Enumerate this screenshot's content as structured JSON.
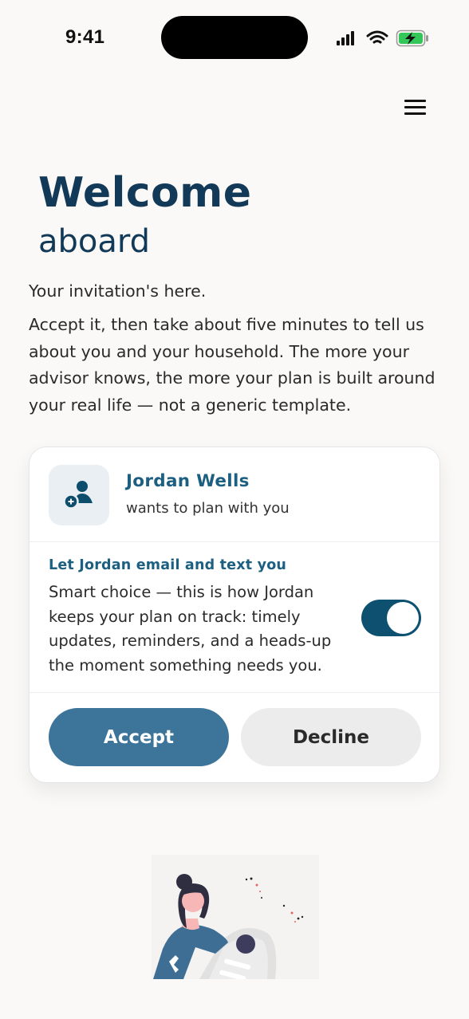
{
  "status_bar": {
    "time": "9:41"
  },
  "header": {
    "title": "Welcome",
    "subtitle": "aboard"
  },
  "intro": "Your invitation's here.",
  "body": "Accept it, then take about five minutes to tell us about you and your household. The more your advisor knows, the more your plan is built around your real life — not a generic template.",
  "invite": {
    "name": "Jordan Wells",
    "wants": "wants to plan with you",
    "consent_title": "Let Jordan email and text you",
    "consent_text": "Smart choice — this is how Jordan keeps your plan on track: timely updates, reminders, and a heads-up the moment something needs you.",
    "consent_enabled": true,
    "accept_label": "Accept",
    "decline_label": "Decline"
  },
  "colors": {
    "brand_dark": "#123a58",
    "brand": "#1c5f80",
    "accept": "#3d7499",
    "toggle_on": "#0d506f",
    "background": "#faf9f7"
  },
  "icons": [
    "cellular-signal-icon",
    "wifi-icon",
    "battery-charging-icon",
    "hamburger-menu-icon",
    "add-person-icon"
  ]
}
